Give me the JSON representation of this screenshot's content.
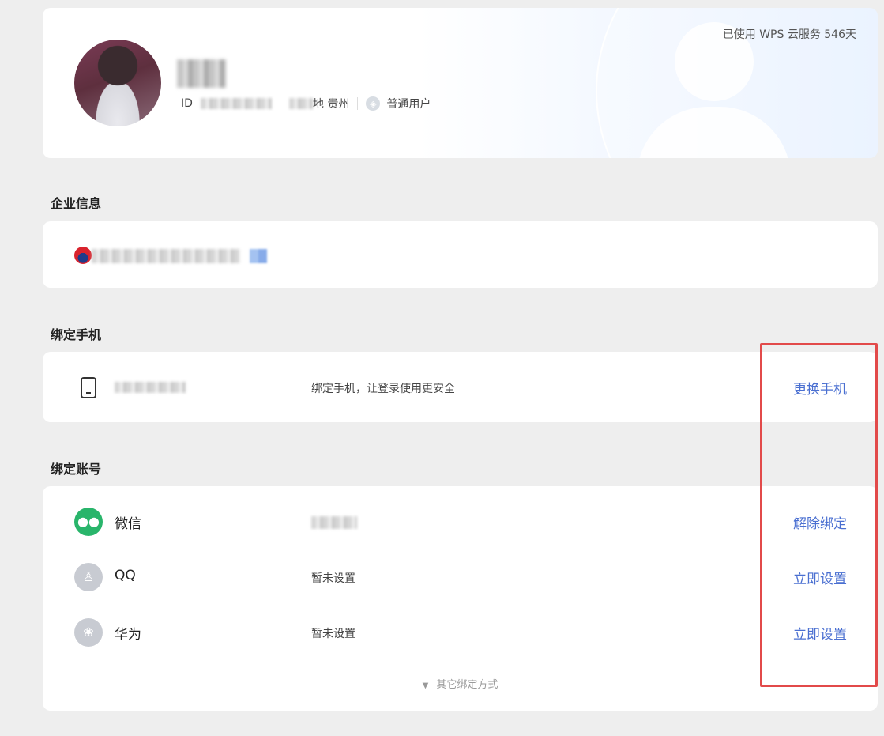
{
  "profile": {
    "cloud_usage": "已使用 WPS 云服务 546天",
    "id_label": "ID",
    "location": "地 贵州",
    "user_type": "普通用户"
  },
  "enterprise": {
    "section_title": "企业信息"
  },
  "phone": {
    "section_title": "绑定手机",
    "hint": "绑定手机，让登录使用更安全",
    "action": "更换手机"
  },
  "accounts": {
    "section_title": "绑定账号",
    "items": [
      {
        "name": "微信",
        "status": "",
        "action": "解除绑定",
        "icon": "wechat-icon"
      },
      {
        "name": "QQ",
        "status": "暂未设置",
        "action": "立即设置",
        "icon": "qq-icon"
      },
      {
        "name": "华为",
        "status": "暂未设置",
        "action": "立即设置",
        "icon": "huawei-icon"
      }
    ],
    "more_methods": "其它绑定方式"
  },
  "colors": {
    "link": "#4a6fd1",
    "highlight": "#e24a4a",
    "wechat": "#29b56b"
  }
}
